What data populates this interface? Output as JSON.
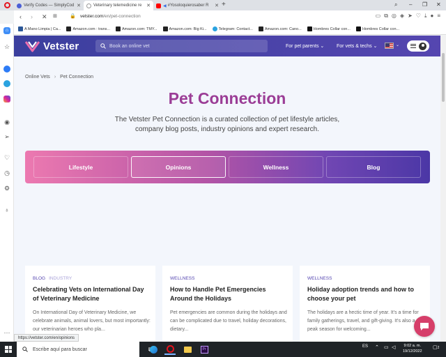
{
  "browser": {
    "tabs": [
      {
        "title": "Verify Codes — SimplyCod",
        "favicon_color": "#4b5fd6"
      },
      {
        "title": "Veterinary telemedicine re",
        "favicon_color": "#999999",
        "active": true
      },
      {
        "title": "#Yosoloquierosaber R",
        "favicon_color": "#ff0000"
      }
    ],
    "address": {
      "domain": "vetster.com",
      "path": "/en/pet-connection"
    },
    "bookmarks": [
      {
        "label": "A Mano Limpia | Ca...",
        "color": "#2b5797"
      },
      {
        "label": "Amazon.com : trans...",
        "color": "#222222"
      },
      {
        "label": "Amazon.com: TMY...",
        "color": "#222222"
      },
      {
        "label": "Amazon.com: Big Ki...",
        "color": "#222222"
      },
      {
        "label": "Telegram: Contact...",
        "color": "#2aa3e0"
      },
      {
        "label": "Amazon.com: Cano...",
        "color": "#222222"
      },
      {
        "label": "Hombres Collar con...",
        "color": "#111111"
      },
      {
        "label": "Hombres Collar con...",
        "color": "#111111"
      }
    ],
    "status_url": "https://vetster.com/en/opinions"
  },
  "site": {
    "logo_text": "Vetster",
    "search_placeholder": "Book an online vet",
    "nav": {
      "pet_parents": "For pet parents",
      "vets": "For vets & techs"
    },
    "colors": {
      "header": "#4a41a8",
      "accent": "#9b3d96",
      "chat": "#d63f6a"
    }
  },
  "breadcrumb": {
    "home": "Online Vets",
    "current": "Pet Connection"
  },
  "hero": {
    "title": "Pet Connection",
    "desc_line1": "The Vetster Pet Connection is a curated collection of pet lifestyle articles,",
    "desc_line2": "company blog posts, industry opinions and expert research."
  },
  "categories": [
    {
      "label": "Lifestyle",
      "active": false
    },
    {
      "label": "Opinions",
      "active": true
    },
    {
      "label": "Wellness",
      "active": false
    },
    {
      "label": "Blog",
      "active": false
    }
  ],
  "cards": [
    {
      "tag1": "BLOG",
      "tag2": "INDUSTRY",
      "title": "Celebrating Vets on International Day of Veterinary Medicine",
      "excerpt": "On International Day of Veterinary Medicine, we celebrate animals, animal lovers, but most importantly: our veterinarian heroes who pla..."
    },
    {
      "tag1": "WELLNESS",
      "tag2": "",
      "title": "How to Handle Pet Emergencies Around the Holidays",
      "excerpt": "Pet emergencies are common during the holidays and can be complicated due to travel, holiday decorations, dietary..."
    },
    {
      "tag1": "WELLNESS",
      "tag2": "",
      "title": "Holiday adoption trends and how to choose your pet",
      "excerpt": "The holidays are a hectic time of year. It's a time for family gatherings, travel, and gift-giving. It's also a peak season for welcoming..."
    }
  ],
  "taskbar": {
    "search_placeholder": "Escribe aquí para buscar",
    "language": "ES",
    "time": "9:02 a. m.",
    "date": "19/12/2022",
    "notification_count": "2"
  }
}
